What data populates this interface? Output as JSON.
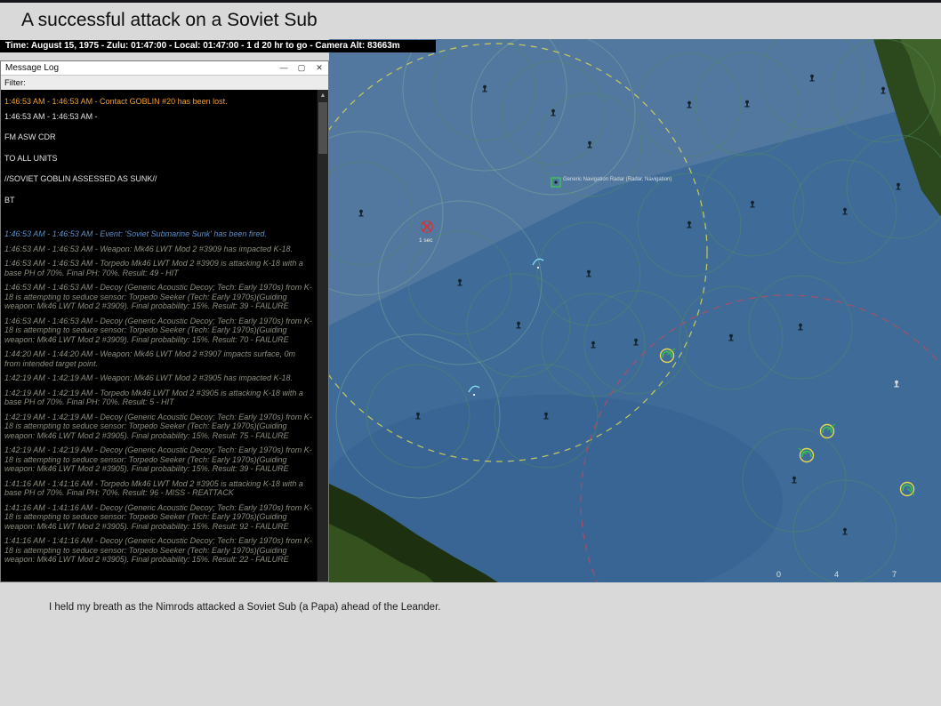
{
  "page": {
    "title": "A successful attack on a Soviet Sub",
    "caption": "I held my breath as the Nimrods attacked a Soviet Sub (a Papa) ahead of the Leander."
  },
  "time_bar": {
    "text": "Time: August 15, 1975 - Zulu: 01:47:00 - Local: 01:47:00 - 1 d 20 hr to go -  Camera Alt: 83663m"
  },
  "message_log": {
    "window_title": "Message Log",
    "filter_label": "Filter:",
    "controls": {
      "minimize": "—",
      "maximize": "▢",
      "close": "✕"
    },
    "kind_colors": {
      "contact": "#f0a030",
      "plain": "#e2e2e2",
      "event": "#5b8fc9",
      "detail": "#8d8d7f"
    },
    "messages": [
      {
        "kind": "contact",
        "text": "1:46:53 AM - 1:46:53 AM - Contact GOBLIN #20 has been lost."
      },
      {
        "kind": "plain",
        "text": "1:46:53 AM - 1:46:53 AM -"
      },
      {
        "kind": "plain",
        "text": "FM ASW CDR"
      },
      {
        "kind": "plain",
        "text": "TO ALL UNITS"
      },
      {
        "kind": "plain",
        "text": "//SOVIET GOBLIN ASSESSED AS SUNK//"
      },
      {
        "kind": "plain",
        "text": "BT"
      },
      {
        "kind": "event",
        "text": "1:46:53 AM - 1:46:53 AM - Event: 'Soviet Submarine Sunk' has been fired."
      },
      {
        "kind": "detail",
        "text": "1:46:53 AM - 1:46:53 AM - Weapon: Mk46 LWT Mod 2 #3909 has impacted K-18."
      },
      {
        "kind": "detail",
        "text": "1:46:53 AM - 1:46:53 AM - Torpedo Mk46 LWT Mod 2 #3909 is attacking K-18 with a base PH of 70%. Final PH: 70%. Result: 49 - HIT"
      },
      {
        "kind": "detail",
        "text": "1:46:53 AM - 1:46:53 AM - Decoy (Generic Acoustic Decoy; Tech: Early 1970s) from K-18 is attempting to seduce sensor: Torpedo Seeker (Tech: Early 1970s)(Guiding weapon: Mk46 LWT Mod 2 #3909). Final probability: 15%. Result: 39 - FAILURE"
      },
      {
        "kind": "detail",
        "text": "1:46:53 AM - 1:46:53 AM - Decoy (Generic Acoustic Decoy; Tech: Early 1970s) from K-18 is attempting to seduce sensor: Torpedo Seeker (Tech: Early 1970s)(Guiding weapon: Mk46 LWT Mod 2 #3909). Final probability: 15%. Result: 70 - FAILURE"
      },
      {
        "kind": "detail",
        "text": "1:44:20 AM - 1:44:20 AM - Weapon: Mk46 LWT Mod 2 #3907 impacts surface, 0m from intended target point."
      },
      {
        "kind": "detail",
        "text": "1:42:19 AM - 1:42:19 AM - Weapon: Mk46 LWT Mod 2 #3905 has impacted K-18."
      },
      {
        "kind": "detail",
        "text": "1:42:19 AM - 1:42:19 AM - Torpedo Mk46 LWT Mod 2 #3905 is attacking K-18 with a base PH of 70%. Final PH: 70%. Result: 5 - HIT"
      },
      {
        "kind": "detail",
        "text": "1:42:19 AM - 1:42:19 AM - Decoy (Generic Acoustic Decoy; Tech: Early 1970s) from K-18 is attempting to seduce sensor: Torpedo Seeker (Tech: Early 1970s)(Guiding weapon: Mk46 LWT Mod 2 #3905). Final probability: 15%. Result: 75 - FAILURE"
      },
      {
        "kind": "detail",
        "text": "1:42:19 AM - 1:42:19 AM - Decoy (Generic Acoustic Decoy; Tech: Early 1970s) from K-18 is attempting to seduce sensor: Torpedo Seeker (Tech: Early 1970s)(Guiding weapon: Mk46 LWT Mod 2 #3905). Final probability: 15%. Result: 39 - FAILURE"
      },
      {
        "kind": "detail",
        "text": "1:41:16 AM - 1:41:16 AM - Torpedo Mk46 LWT Mod 2 #3905 is attacking K-18 with a base PH of 70%. Final PH: 70%. Result: 96 - MISS - REATTACK"
      },
      {
        "kind": "detail",
        "text": "1:41:16 AM - 1:41:16 AM - Decoy (Generic Acoustic Decoy; Tech: Early 1970s) from K-18 is attempting to seduce sensor: Torpedo Seeker (Tech: Early 1970s)(Guiding weapon: Mk46 LWT Mod 2 #3905). Final probability: 15%. Result: 92 - FAILURE"
      },
      {
        "kind": "detail",
        "text": "1:41:16 AM - 1:41:16 AM - Decoy (Generic Acoustic Decoy; Tech: Early 1970s) from K-18 is attempting to seduce sensor: Torpedo Seeker (Tech: Early 1970s)(Guiding weapon: Mk46 LWT Mod 2 #3905). Final probability: 15%. Result: 22 - FAILURE"
      }
    ]
  },
  "map": {
    "radar_label": "Generic Navigation Radar (Radar, Navigation)",
    "contact_label": "1 sec",
    "scale_ticks": [
      "0",
      "4",
      "7"
    ],
    "colors": {
      "ocean": "#3f6b99",
      "land": "#2c481d",
      "sensor_ring_yellow": "#d6d554",
      "threat_ring_red": "#bb4a5e",
      "detection_green": "#4e8a62",
      "friendly_green": "#38c24f",
      "hostile_red": "#d93030"
    }
  }
}
